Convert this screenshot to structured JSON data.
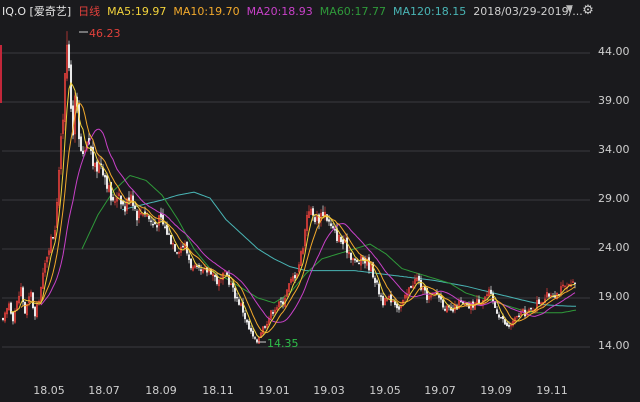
{
  "header": {
    "symbol": "IQ.O [爱奇艺]",
    "period": "日线",
    "ma5": "MA5:19.97",
    "ma10": "MA10:19.70",
    "ma20": "MA20:18.93",
    "ma60": "MA60:17.77",
    "ma120": "MA120:18.15",
    "date_range": "2018/03/29-2019/..."
  },
  "colors": {
    "background": "#1a1a1d",
    "up_candle": "#e0403b",
    "down_candle": "#eaeaea",
    "ma5": "#f2d33c",
    "ma10": "#f2a92c",
    "ma20": "#c841c8",
    "ma60": "#2f9a3a",
    "ma120": "#49b5b5",
    "grid": "#3a3a3e"
  },
  "icons": {
    "dropdown": "triangle-down-icon",
    "settings": "gear-icon"
  },
  "annotations": {
    "high": "46.23",
    "low": "14.35"
  },
  "chart_data": {
    "type": "candlestick",
    "y_ticks": [
      "44.00",
      "39.00",
      "34.00",
      "29.00",
      "24.00",
      "19.00",
      "14.00"
    ],
    "x_ticks": [
      "18.05",
      "18.07",
      "18.09",
      "18.11",
      "19.01",
      "19.03",
      "19.05",
      "19.07",
      "19.09",
      "19.11"
    ],
    "y_range": [
      12.5,
      47.5
    ],
    "grid": "horizontal",
    "price_keypoints": [
      [
        0,
        16.5
      ],
      [
        6,
        18.5
      ],
      [
        10,
        17.0
      ],
      [
        18,
        20.0
      ],
      [
        22,
        17.5
      ],
      [
        28,
        19.5
      ],
      [
        32,
        17.0
      ],
      [
        38,
        20.0
      ],
      [
        45,
        24.0
      ],
      [
        52,
        26.0
      ],
      [
        56,
        32.0
      ],
      [
        60,
        37.0
      ],
      [
        62,
        42.0
      ],
      [
        64,
        46.23
      ],
      [
        67,
        40.0
      ],
      [
        70,
        36.0
      ],
      [
        73,
        40.0
      ],
      [
        76,
        35.0
      ],
      [
        80,
        33.0
      ],
      [
        86,
        35.0
      ],
      [
        92,
        32.0
      ],
      [
        98,
        33.0
      ],
      [
        104,
        31.0
      ],
      [
        110,
        28.5
      ],
      [
        116,
        30.0
      ],
      [
        122,
        28.0
      ],
      [
        128,
        30.0
      ],
      [
        134,
        27.5
      ],
      [
        142,
        28.0
      ],
      [
        150,
        26.5
      ],
      [
        158,
        27.0
      ],
      [
        166,
        25.5
      ],
      [
        174,
        24.0
      ],
      [
        182,
        24.5
      ],
      [
        190,
        22.0
      ],
      [
        200,
        21.5
      ],
      [
        208,
        22.0
      ],
      [
        216,
        20.5
      ],
      [
        224,
        21.5
      ],
      [
        232,
        19.5
      ],
      [
        240,
        18.0
      ],
      [
        246,
        16.0
      ],
      [
        250,
        15.2
      ],
      [
        254,
        14.35
      ],
      [
        258,
        15.5
      ],
      [
        264,
        16.5
      ],
      [
        272,
        18.0
      ],
      [
        280,
        18.5
      ],
      [
        288,
        20.5
      ],
      [
        296,
        22.0
      ],
      [
        302,
        25.0
      ],
      [
        306,
        28.5
      ],
      [
        310,
        27.5
      ],
      [
        316,
        27.0
      ],
      [
        322,
        28.0
      ],
      [
        330,
        26.0
      ],
      [
        338,
        25.0
      ],
      [
        346,
        24.0
      ],
      [
        354,
        22.5
      ],
      [
        362,
        23.0
      ],
      [
        370,
        22.0
      ],
      [
        376,
        20.0
      ],
      [
        382,
        18.5
      ],
      [
        390,
        19.0
      ],
      [
        398,
        18.0
      ],
      [
        404,
        19.0
      ],
      [
        410,
        20.5
      ],
      [
        416,
        21.0
      ],
      [
        422,
        19.5
      ],
      [
        428,
        19.0
      ],
      [
        436,
        19.5
      ],
      [
        444,
        18.0
      ],
      [
        450,
        17.5
      ],
      [
        458,
        18.5
      ],
      [
        466,
        18.0
      ],
      [
        474,
        18.5
      ],
      [
        482,
        19.0
      ],
      [
        488,
        19.5
      ],
      [
        494,
        18.0
      ],
      [
        500,
        17.0
      ],
      [
        506,
        16.0
      ],
      [
        512,
        16.5
      ],
      [
        520,
        17.5
      ],
      [
        528,
        17.5
      ],
      [
        536,
        18.5
      ],
      [
        544,
        19.0
      ],
      [
        550,
        19.5
      ],
      [
        556,
        19.5
      ],
      [
        562,
        20.0
      ],
      [
        568,
        20.0
      ],
      [
        574,
        20.5
      ]
    ],
    "ma60_keypoints": [
      [
        80,
        24.0
      ],
      [
        96,
        27.5
      ],
      [
        112,
        30.0
      ],
      [
        128,
        31.5
      ],
      [
        144,
        31.0
      ],
      [
        160,
        29.5
      ],
      [
        176,
        27.0
      ],
      [
        192,
        24.0
      ],
      [
        208,
        22.0
      ],
      [
        224,
        21.0
      ],
      [
        240,
        20.0
      ],
      [
        256,
        19.0
      ],
      [
        272,
        18.5
      ],
      [
        288,
        19.5
      ],
      [
        304,
        21.5
      ],
      [
        320,
        23.0
      ],
      [
        336,
        23.5
      ],
      [
        352,
        24.0
      ],
      [
        368,
        24.5
      ],
      [
        384,
        23.5
      ],
      [
        400,
        22.0
      ],
      [
        416,
        21.5
      ],
      [
        432,
        21.0
      ],
      [
        448,
        20.5
      ],
      [
        464,
        19.5
      ],
      [
        480,
        19.0
      ],
      [
        496,
        18.5
      ],
      [
        512,
        18.0
      ],
      [
        528,
        17.5
      ],
      [
        544,
        17.5
      ],
      [
        560,
        17.5
      ],
      [
        574,
        17.77
      ]
    ],
    "ma120_keypoints": [
      [
        120,
        28.0
      ],
      [
        140,
        28.5
      ],
      [
        160,
        29.0
      ],
      [
        176,
        29.5
      ],
      [
        192,
        29.8
      ],
      [
        208,
        29.2
      ],
      [
        224,
        27.0
      ],
      [
        240,
        25.5
      ],
      [
        256,
        24.0
      ],
      [
        272,
        23.0
      ],
      [
        288,
        22.2
      ],
      [
        304,
        21.8
      ],
      [
        320,
        21.8
      ],
      [
        336,
        21.8
      ],
      [
        352,
        21.8
      ],
      [
        368,
        21.6
      ],
      [
        384,
        21.4
      ],
      [
        400,
        21.2
      ],
      [
        416,
        21.0
      ],
      [
        432,
        20.8
      ],
      [
        448,
        20.5
      ],
      [
        464,
        20.2
      ],
      [
        480,
        19.8
      ],
      [
        496,
        19.4
      ],
      [
        512,
        19.0
      ],
      [
        528,
        18.6
      ],
      [
        544,
        18.3
      ],
      [
        560,
        18.2
      ],
      [
        574,
        18.15
      ]
    ]
  }
}
